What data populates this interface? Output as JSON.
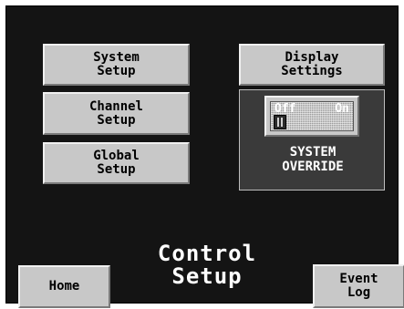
{
  "buttons": {
    "system_setup": "System\nSetup",
    "channel_setup": "Channel\nSetup",
    "global_setup": "Global\nSetup",
    "display_settings": "Display\nSettings",
    "home": "Home",
    "event_log": "Event\nLog"
  },
  "override": {
    "switch_off_label": "Off",
    "switch_on_label": "On",
    "state": "Off",
    "label": "SYSTEM\nOVERRIDE"
  },
  "page": {
    "title": "Control\nSetup"
  },
  "colors": {
    "panel_background": "#141414",
    "button_face": "#c8c8c8",
    "override_panel": "#3a3a3a",
    "text_light": "#ffffff",
    "text_dark": "#000000"
  }
}
